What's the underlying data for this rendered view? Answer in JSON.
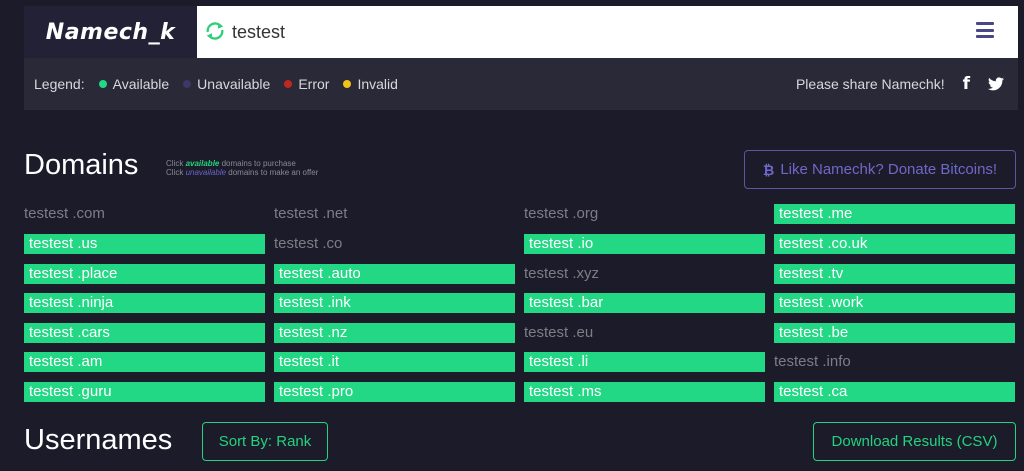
{
  "brand": {
    "name": "Namech_k"
  },
  "search": {
    "value": "testest"
  },
  "colors": {
    "available": "#22d884",
    "unavailable": "#3a3865",
    "error": "#c0281f",
    "invalid": "#f0c419",
    "accent": "#22d37f",
    "donate": "#6e69c9"
  },
  "legend": {
    "label": "Legend:",
    "items": [
      {
        "label": "Available",
        "color": "#22d884"
      },
      {
        "label": "Unavailable",
        "color": "#3a3865"
      },
      {
        "label": "Error",
        "color": "#c0281f"
      },
      {
        "label": "Invalid",
        "color": "#f0c419"
      }
    ]
  },
  "share": {
    "text": "Please share Namechk!",
    "facebook_icon": "facebook-icon",
    "twitter_icon": "twitter-icon"
  },
  "domains": {
    "title": "Domains",
    "hint": {
      "line1_pre": "Click ",
      "line1_em": "available",
      "line1_post": " domains to purchase",
      "line2_pre": "Click ",
      "line2_em": "unavailable",
      "line2_post": " domains to make an offer"
    },
    "donate_label": "Like Namechk? Donate Bitcoins!",
    "donate_icon": "bitcoin-icon",
    "rows": [
      [
        {
          "name": "testest .com",
          "status": "unavailable"
        },
        {
          "name": "testest .net",
          "status": "unavailable"
        },
        {
          "name": "testest .org",
          "status": "unavailable"
        },
        {
          "name": "testest .me",
          "status": "available"
        }
      ],
      [
        {
          "name": "testest .us",
          "status": "available"
        },
        {
          "name": "testest .co",
          "status": "unavailable"
        },
        {
          "name": "testest .io",
          "status": "available"
        },
        {
          "name": "testest .co.uk",
          "status": "available"
        }
      ],
      [
        {
          "name": "testest .place",
          "status": "available"
        },
        {
          "name": "testest .auto",
          "status": "available"
        },
        {
          "name": "testest .xyz",
          "status": "unavailable"
        },
        {
          "name": "testest .tv",
          "status": "available"
        }
      ],
      [
        {
          "name": "testest .ninja",
          "status": "available"
        },
        {
          "name": "testest .ink",
          "status": "available"
        },
        {
          "name": "testest .bar",
          "status": "available"
        },
        {
          "name": "testest .work",
          "status": "available"
        }
      ],
      [
        {
          "name": "testest .cars",
          "status": "available"
        },
        {
          "name": "testest .nz",
          "status": "available"
        },
        {
          "name": "testest .eu",
          "status": "unavailable"
        },
        {
          "name": "testest .be",
          "status": "available"
        }
      ],
      [
        {
          "name": "testest .am",
          "status": "available"
        },
        {
          "name": "testest .it",
          "status": "available"
        },
        {
          "name": "testest .li",
          "status": "available"
        },
        {
          "name": "testest .info",
          "status": "unavailable"
        }
      ],
      [
        {
          "name": "testest .guru",
          "status": "available"
        },
        {
          "name": "testest .pro",
          "status": "available"
        },
        {
          "name": "testest .ms",
          "status": "available"
        },
        {
          "name": "testest .ca",
          "status": "available"
        }
      ]
    ]
  },
  "usernames": {
    "title": "Usernames",
    "sort_label": "Sort By: Rank",
    "download_label": "Download Results (CSV)"
  }
}
